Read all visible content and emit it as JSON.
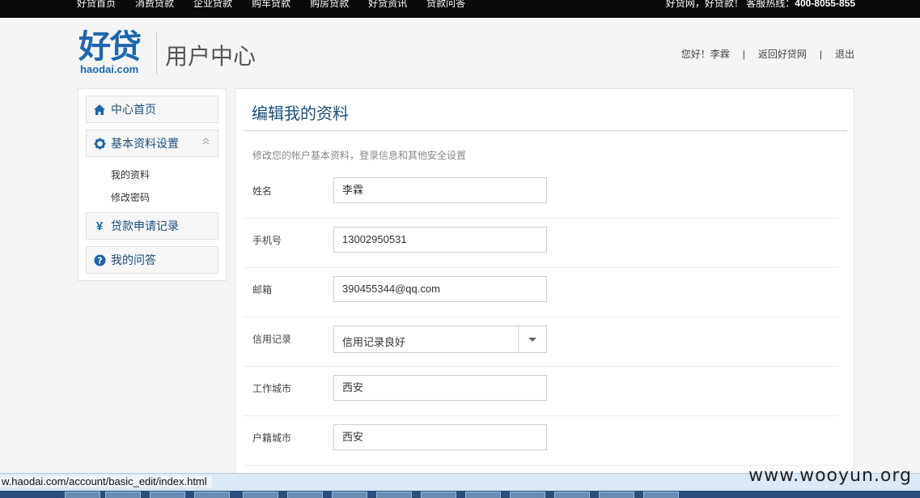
{
  "topbar": {
    "nav": [
      "好贷首页",
      "消费贷款",
      "企业贷款",
      "购车贷款",
      "购房贷款",
      "好贷资讯",
      "贷款问答"
    ],
    "greeting": "好贷网，好贷款！ 客服热线：",
    "hotline": "400-8055-855"
  },
  "header": {
    "logo_cn": "好贷",
    "logo_en": "haodai.com",
    "title": "用户中心",
    "user_greeting": "您好！李霖",
    "back_link": "返回好贷网",
    "logout": "退出"
  },
  "sidebar": {
    "items": [
      {
        "label": "中心首页",
        "icon": "home-icon"
      },
      {
        "label": "基本资料设置",
        "icon": "gear-icon"
      },
      {
        "label": "贷款申请记录",
        "icon": "yen-icon"
      },
      {
        "label": "我的问答",
        "icon": "question-icon"
      }
    ],
    "sub_items": [
      "我的资料",
      "修改密码"
    ]
  },
  "main": {
    "title": "编辑我的资料",
    "description": "修改您的帐户基本资料，登录信息和其他安全设置",
    "fields": {
      "name": {
        "label": "姓名",
        "value": "李霖"
      },
      "phone": {
        "label": "手机号",
        "value": "13002950531"
      },
      "email": {
        "label": "邮箱",
        "value": "390455344@qq.com"
      },
      "credit": {
        "label": "信用记录",
        "value": "信用记录良好"
      },
      "work_city": {
        "label": "工作城市",
        "value": "西安"
      },
      "hukou_city": {
        "label": "户籍城市",
        "value": "西安"
      }
    }
  },
  "statusbar": {
    "url": "w.haodai.com/account/basic_edit/index.html",
    "watermark": "www.wooyun.org"
  },
  "colors": {
    "brand_blue": "#1c67b0",
    "topbar_bg": "#0a0a0a",
    "page_bg": "#f5f5f5"
  }
}
